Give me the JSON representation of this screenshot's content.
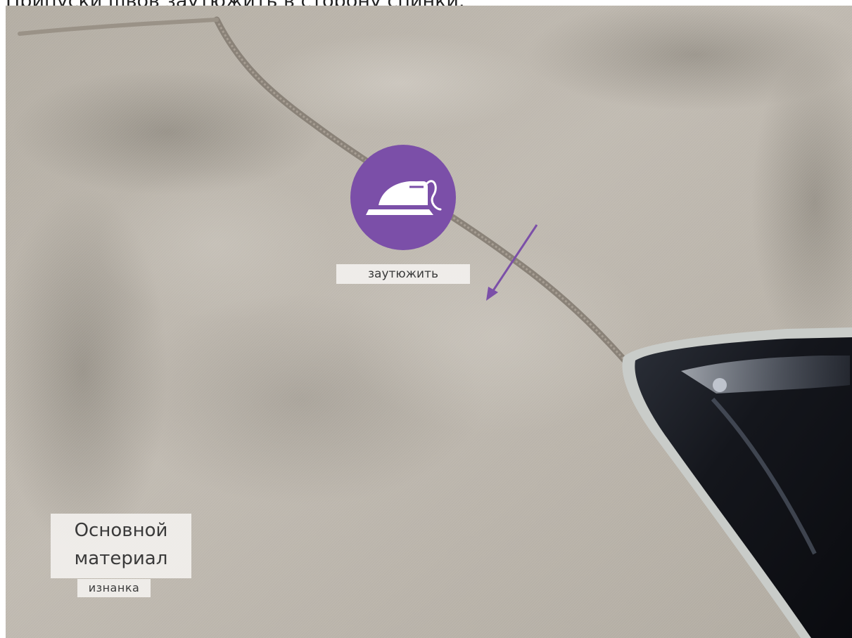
{
  "caption": {
    "text": "Припуски швов заутюжить в сторону спинки."
  },
  "photo": {
    "subject": "fabric-seam-with-iron",
    "colors": {
      "fabric": "#b8b2a8",
      "fabric_shadow": "#8f8a81",
      "seam": "#8a8278",
      "iron_body": "#1c1f26",
      "iron_edge": "#c9ccc9",
      "accent": "#7b4fa8"
    }
  },
  "icon": {
    "name": "iron-icon"
  },
  "labels": {
    "action": "заутюжить",
    "material_line1": "Основной",
    "material_line2": "материал",
    "side": "изнанка"
  }
}
